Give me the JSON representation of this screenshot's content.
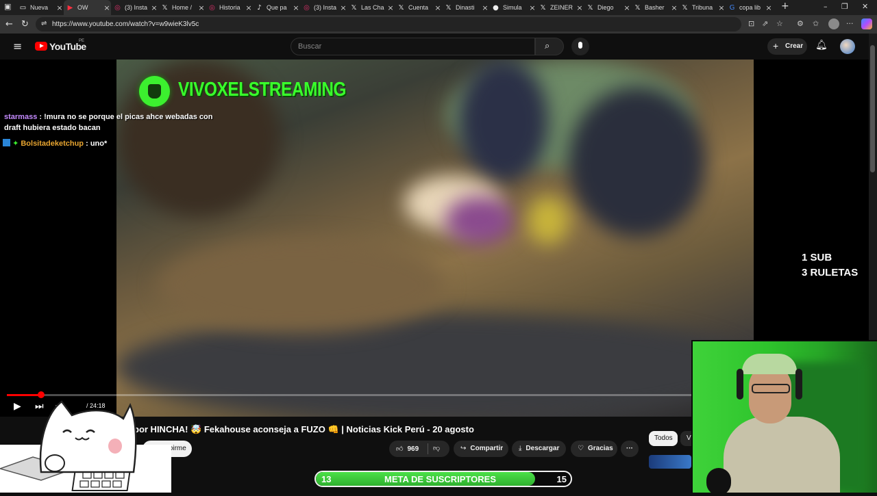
{
  "browser": {
    "tabs": [
      {
        "label": "Nueva",
        "icon": "tab-icon"
      },
      {
        "label": "OW",
        "icon": "youtube-icon"
      },
      {
        "label": "(3) Insta",
        "icon": "instagram-icon"
      },
      {
        "label": "Home /",
        "icon": "x-icon"
      },
      {
        "label": "Historia",
        "icon": "instagram-icon"
      },
      {
        "label": "Que pa",
        "icon": "tiktok-icon"
      },
      {
        "label": "(3) Insta",
        "icon": "instagram-icon"
      },
      {
        "label": "Las Cha",
        "icon": "x-icon"
      },
      {
        "label": "Cuenta",
        "icon": "x-icon"
      },
      {
        "label": "Dinasti",
        "icon": "x-icon"
      },
      {
        "label": "Simula",
        "icon": "site-icon"
      },
      {
        "label": "ZEINER",
        "icon": "x-icon"
      },
      {
        "label": "Diego",
        "icon": "x-icon"
      },
      {
        "label": "Basher",
        "icon": "x-icon"
      },
      {
        "label": "Tribuna",
        "icon": "x-icon"
      },
      {
        "label": "copa lib",
        "icon": "google-icon"
      }
    ],
    "url": "https://www.youtube.com/watch?v=w9wieK3lv5c"
  },
  "youtube": {
    "logo": "YouTube",
    "region": "PE",
    "search_placeholder": "Buscar",
    "create_label": "Crear"
  },
  "overlay": {
    "brand": "VIVOXELSTREAMING",
    "chat": [
      {
        "user": "starmass",
        "text": ": !mura no se porque el picas ahce webadas con draft hubiera estado bacan",
        "color": "#c58bff"
      },
      {
        "user": "Bolsitadeketchup",
        "text": ": uno*",
        "color": "#e8a530"
      }
    ],
    "sub_line1": "1 SUB",
    "sub_line2": "3 RULETAS",
    "goal": {
      "current": "13",
      "label": "META DE SUSCRIPTORES",
      "target": "15",
      "progress": 0.86
    }
  },
  "player": {
    "time": "/ 24:18",
    "progress": 0.05
  },
  "video": {
    "title": "por HINCHA! 🤯 Fekahouse aconseja a FUZO 👊 | Noticias Kick Perú - 20 agosto",
    "subscribe_label": "Suscribirme",
    "likes": "969",
    "share_label": "Compartir",
    "download_label": "Descargar",
    "thanks_label": "Gracias",
    "more_label": "···"
  },
  "chips": {
    "all": "Todos",
    "next": "Vi"
  }
}
